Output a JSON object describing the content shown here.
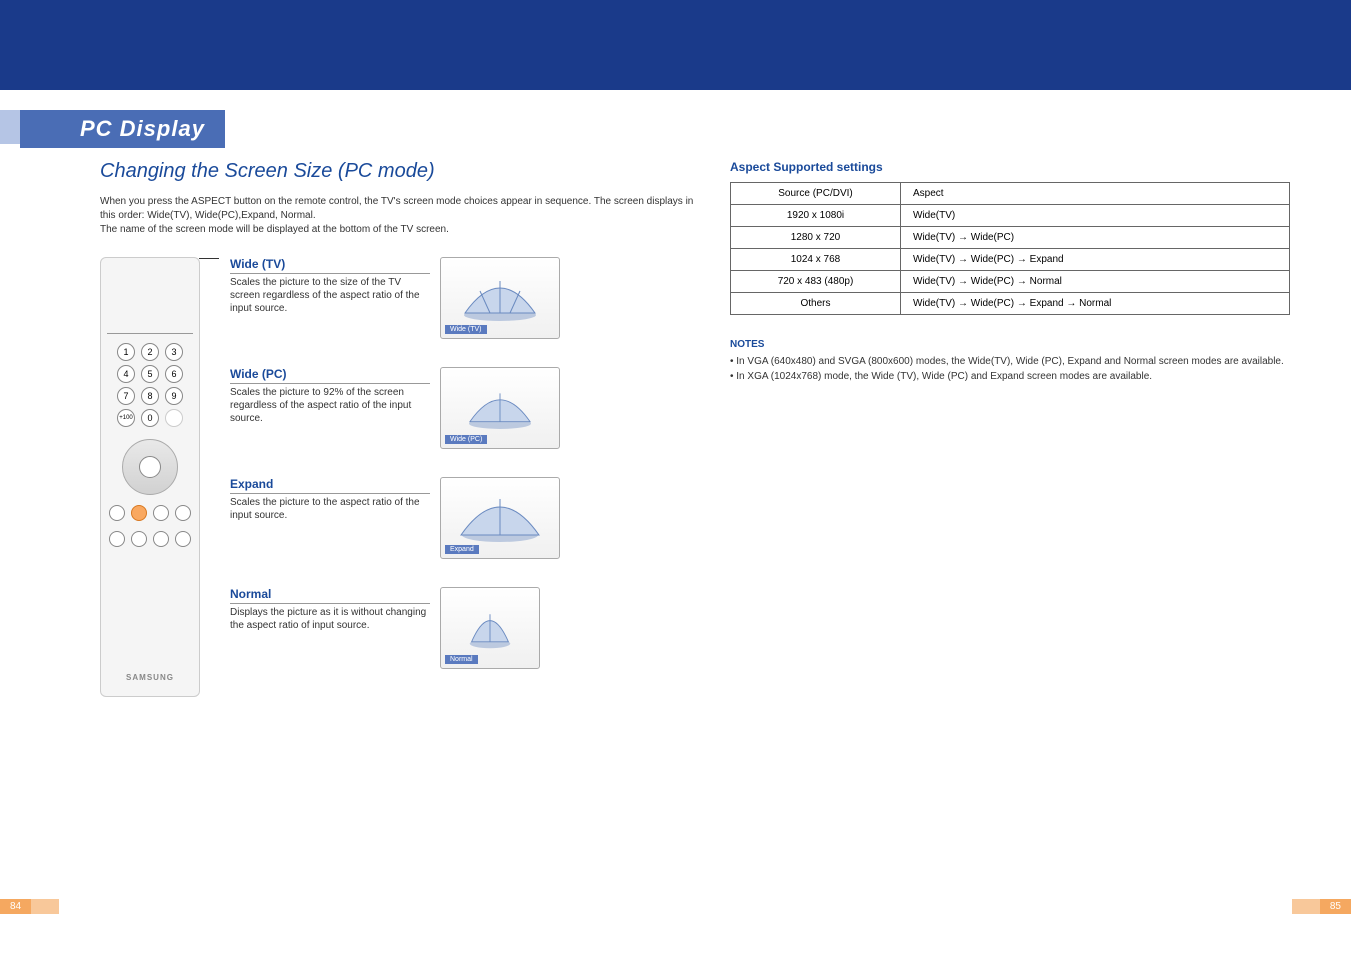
{
  "section_tab": "PC Display",
  "heading": "Changing the Screen Size (PC mode)",
  "intro_line1": "When you press the ASPECT button on the remote control, the TV's screen mode choices appear in sequence.  The screen displays in this order: Wide(TV), Wide(PC),Expand, Normal.",
  "intro_line2": "The name of the screen mode will be displayed at the bottom of the TV screen.",
  "remote_brand": "SAMSUNG",
  "modes": [
    {
      "title": "Wide (TV)",
      "desc": "Scales the picture to the size of the TV screen regardless of the aspect ratio of the input source.",
      "tag": "Wide (TV)",
      "narrow": false
    },
    {
      "title": "Wide (PC)",
      "desc": "Scales the picture to 92% of the screen regardless of the aspect ratio of the input source.",
      "tag": "Wide (PC)",
      "narrow": false
    },
    {
      "title": "Expand",
      "desc": "Scales the picture to the aspect ratio of the input source.",
      "tag": "Expand",
      "narrow": false
    },
    {
      "title": "Normal",
      "desc": "Displays the picture as it is without changing the aspect ratio of input source.",
      "tag": "Normal",
      "narrow": true
    }
  ],
  "aspect_heading": "Aspect Supported settings",
  "aspect_table": {
    "col1_header": "Source (PC/DVI)",
    "col2_header": "Aspect",
    "rows": [
      {
        "source": "1920 x 1080i",
        "aspect": "Wide(TV)"
      },
      {
        "source": "1280 x 720",
        "aspect": "Wide(TV) → Wide(PC)"
      },
      {
        "source": "1024 x 768",
        "aspect": "Wide(TV) → Wide(PC) → Expand"
      },
      {
        "source": "720 x 483 (480p)",
        "aspect": "Wide(TV) → Wide(PC) → Normal"
      },
      {
        "source": "Others",
        "aspect": "Wide(TV) → Wide(PC) → Expand → Normal"
      }
    ]
  },
  "notes_title": "NOTES",
  "notes": [
    "In VGA (640x480) and SVGA (800x600) modes, the Wide(TV), Wide (PC), Expand and Normal screen modes are available.",
    "In XGA (1024x768) mode, the Wide (TV), Wide (PC) and Expand screen modes are available."
  ],
  "page_left": "84",
  "page_right": "85"
}
